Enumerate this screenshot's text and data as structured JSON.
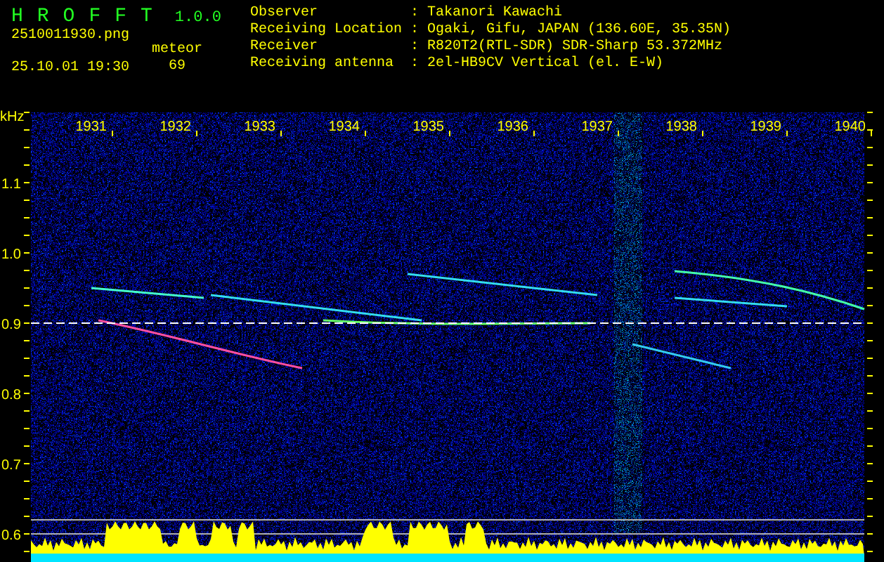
{
  "header": {
    "app_name": "HROFFT",
    "version": "1.0.0",
    "file_name": "2510011930.png",
    "timestamp": "25.10.01 19:30",
    "count_label": "meteor",
    "count": "69"
  },
  "station_info": [
    {
      "label": "Observer",
      "separator": ":",
      "value": "Takanori Kawachi"
    },
    {
      "label": "Receiving Location",
      "separator": ":",
      "value": "Ogaki, Gifu, JAPAN (136.60E, 35.35N)"
    },
    {
      "label": "Receiver",
      "separator": ":",
      "value": "R820T2(RTL-SDR) SDR-Sharp 53.372MHz"
    },
    {
      "label": "Receiving antenna",
      "separator": ":",
      "value": "2el-HB9CV Vertical (el. E-W)"
    }
  ],
  "spectrogram": {
    "y_unit": "kHz",
    "x_labels": [
      "1931",
      "1932",
      "1933",
      "1934",
      "1935",
      "1936",
      "1937",
      "1938",
      "1939",
      "1940"
    ],
    "y_labels": [
      "1.1",
      "1.0",
      "0.9",
      "0.8",
      "0.7",
      "0.6"
    ]
  }
}
